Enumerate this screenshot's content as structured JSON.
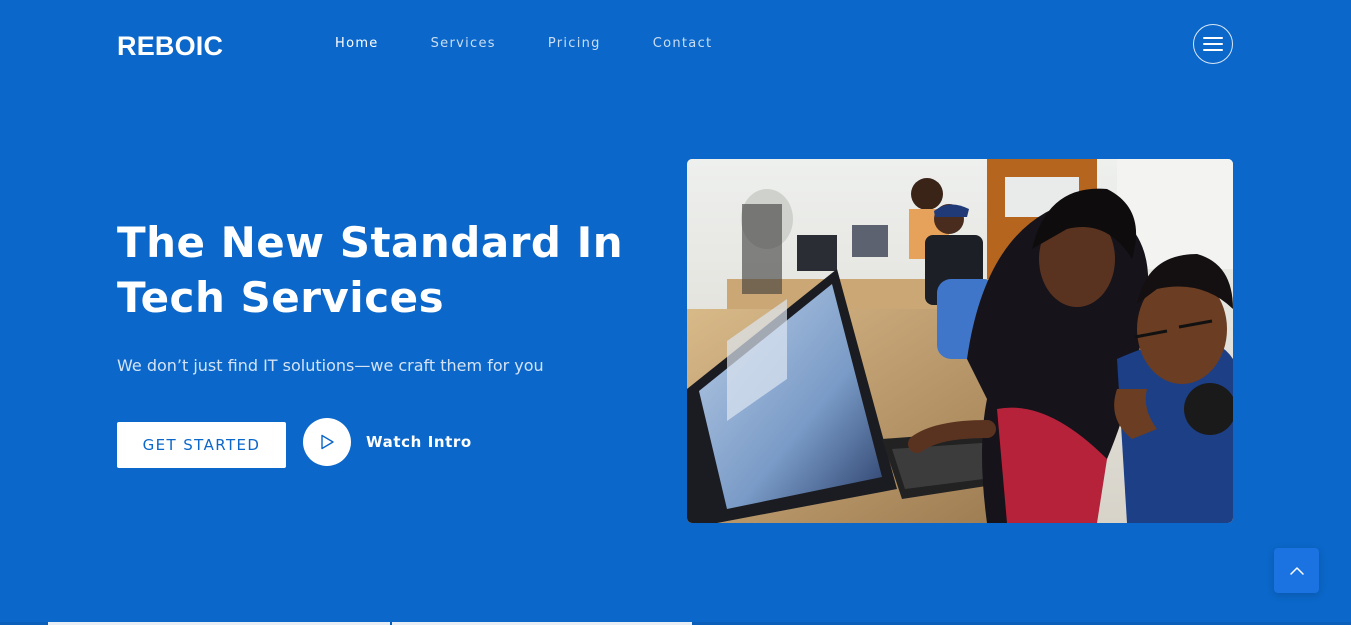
{
  "brand": {
    "logo": "REBOIC"
  },
  "nav": {
    "items": [
      {
        "label": "Home",
        "active": true
      },
      {
        "label": "Services",
        "active": false
      },
      {
        "label": "Pricing",
        "active": false
      },
      {
        "label": "Contact",
        "active": false
      }
    ],
    "menu_icon": "hamburger-icon"
  },
  "hero": {
    "title_line1": "The New Standard In",
    "title_line2": "Tech Services",
    "subtitle": "We don’t just find IT solutions—we craft them for you",
    "cta_label": "GET STARTED",
    "watch_label": "Watch Intro",
    "play_icon": "play-icon",
    "image_subject": "team-working-at-computers-photo"
  },
  "scroll_top_icon": "chevron-up-icon",
  "colors": {
    "background": "#0b67c9",
    "accent": "#1a73e0",
    "text": "#ffffff"
  }
}
